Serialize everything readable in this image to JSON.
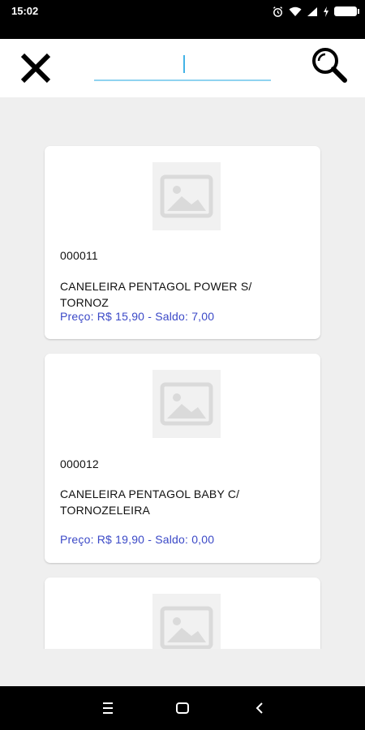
{
  "status_bar": {
    "time": "15:02",
    "battery": "",
    "icons": [
      "alarm-icon",
      "wifi-icon",
      "signal-icon",
      "charging-icon",
      "battery-icon"
    ]
  },
  "toolbar": {
    "close_icon": "close-icon",
    "search_value": "",
    "search_icon": "search-icon",
    "accent_color": "#43b3e6"
  },
  "products": [
    {
      "code": "000011",
      "name": "CANELEIRA PENTAGOL POWER S/ TORNOZ",
      "price_line": "Preço: R$ 15,90 - Saldo: 7,00"
    },
    {
      "code": "000012",
      "name": "CANELEIRA PENTAGOL BABY C/ TORNOZELEIRA",
      "price_line": "Preço: R$ 19,90 - Saldo: 0,00"
    },
    {
      "code": "",
      "name": "",
      "price_line": ""
    }
  ],
  "nav": {
    "icons": [
      "menu-icon",
      "home-icon",
      "back-icon"
    ]
  },
  "colors": {
    "price_text": "#3b49c7",
    "background": "#efefef"
  }
}
